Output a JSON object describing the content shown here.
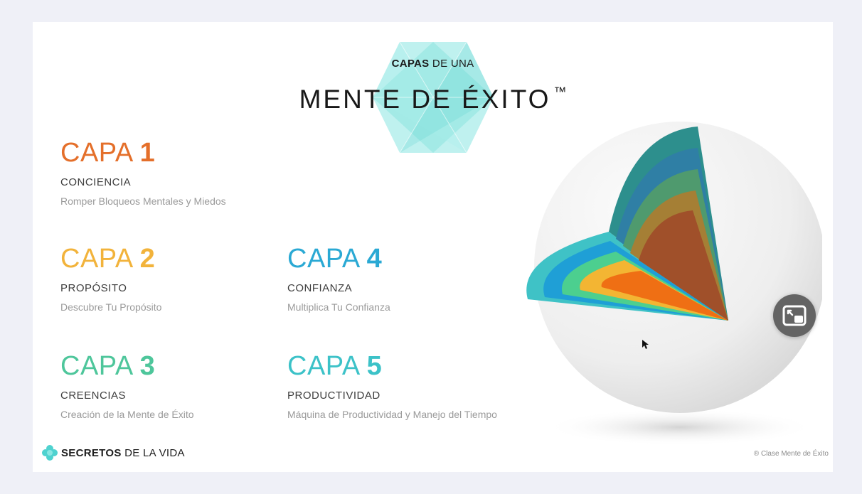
{
  "header": {
    "eyebrow_bold": "CAPAS",
    "eyebrow_rest": " DE UNA",
    "title": "MENTE DE ÉXITO",
    "trademark": "™"
  },
  "layers": [
    {
      "word": "CAPA ",
      "number": "1",
      "name": "CONCIENCIA",
      "description": "Romper Bloqueos Mentales y Miedos",
      "color": "#e46f2a"
    },
    {
      "word": "CAPA ",
      "number": "2",
      "name": "PROPÓSITO",
      "description": "Descubre Tu Propósito",
      "color": "#f2b33b"
    },
    {
      "word": "CAPA ",
      "number": "3",
      "name": "CREENCIAS",
      "description": "Creación de la Mente de Éxito",
      "color": "#4ec69b"
    },
    {
      "word": "CAPA ",
      "number": "4",
      "name": "CONFIANZA",
      "description": "Multiplica Tu Confianza",
      "color": "#2aa9d4"
    },
    {
      "word": "CAPA ",
      "number": "5",
      "name": "PRODUCTIVIDAD",
      "description": "Máquina de Productividad y Manejo del Tiempo",
      "color": "#3cc2c8"
    }
  ],
  "brand": {
    "bold": "SECRETOS",
    "rest": " DE LA VIDA"
  },
  "copyright": "® Clase Mente de Éxito",
  "icons": [
    "hexagon-logo-icon",
    "layered-sphere-illustration",
    "flower-logo-icon",
    "picture-in-picture-icon",
    "mouse-cursor-icon"
  ],
  "colors": {
    "background": "#eff0f7",
    "slide": "#ffffff",
    "hexagon": "#7fe3e0",
    "pip_button": "#646464"
  }
}
